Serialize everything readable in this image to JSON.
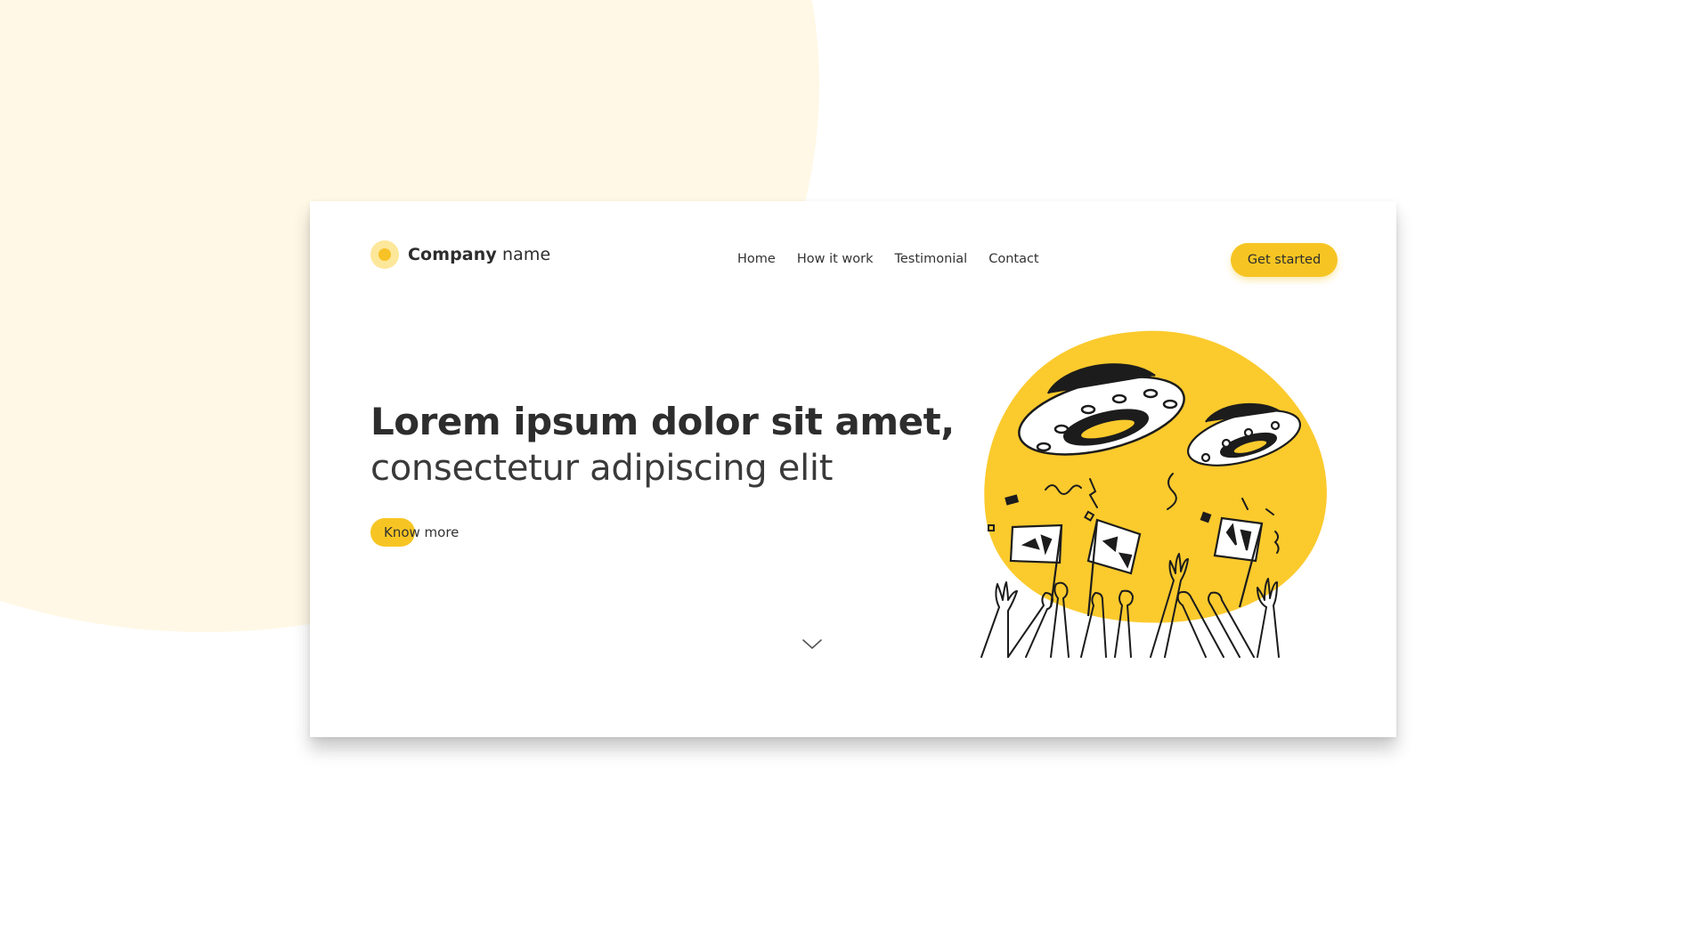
{
  "brand": {
    "name_bold": "Company",
    "name_rest": " name",
    "accent_color": "#f7c523",
    "background_tint": "#fff8e6"
  },
  "nav": {
    "items": [
      {
        "label": "Home"
      },
      {
        "label": "How it work"
      },
      {
        "label": "Testimonial"
      },
      {
        "label": "Contact"
      }
    ]
  },
  "header": {
    "cta_label": "Get started"
  },
  "hero": {
    "title_line1": "Lorem ipsum dolor sit amet,",
    "title_line2": "consectetur adipiscing elit",
    "button_label": "Know more"
  },
  "icons": {
    "logo": "sun-circle-icon",
    "scroll": "chevron-down-icon",
    "illustration": "ufo-crowd-illustration"
  }
}
